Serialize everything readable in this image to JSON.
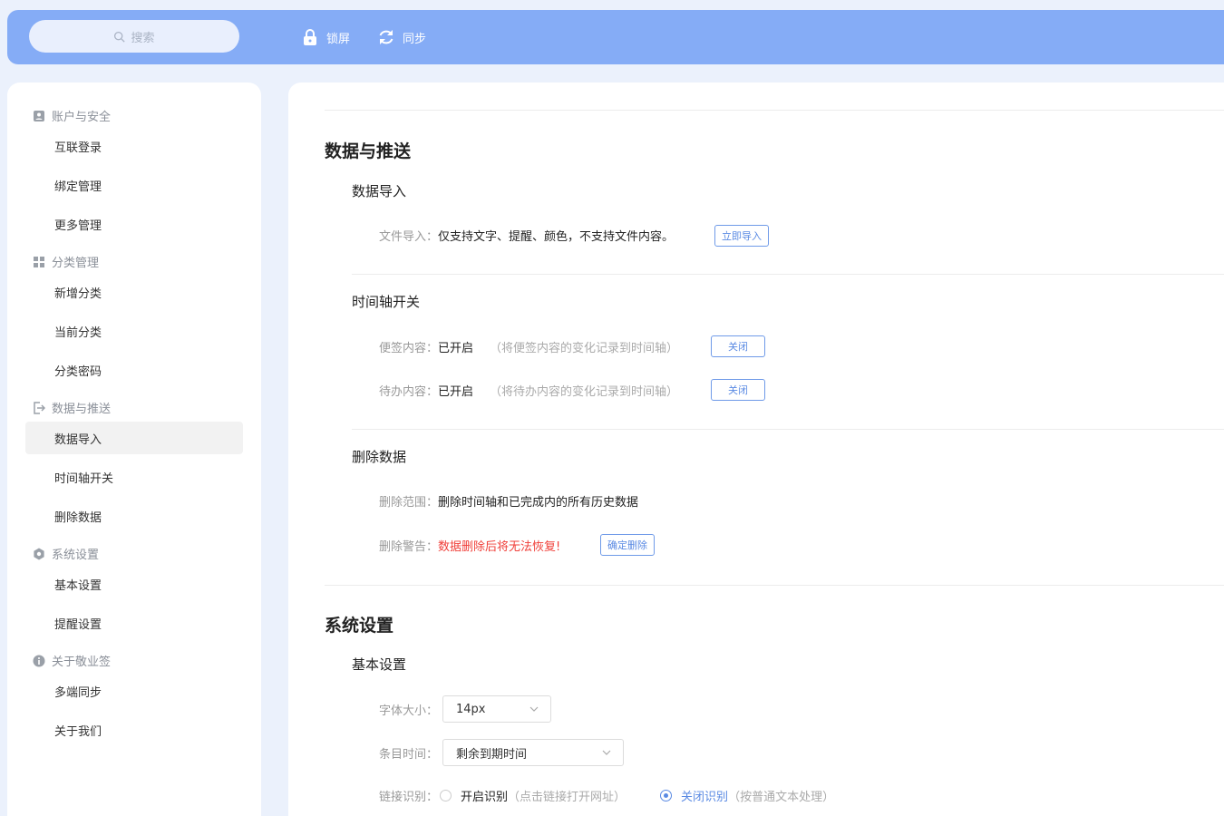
{
  "topbar": {
    "search_placeholder": "搜索",
    "lock_label": "锁屏",
    "sync_label": "同步"
  },
  "sidebar": {
    "groups": [
      {
        "title": "账户与安全",
        "icon": "account-icon",
        "items": [
          "互联登录",
          "绑定管理",
          "更多管理"
        ]
      },
      {
        "title": "分类管理",
        "icon": "grid-icon",
        "items": [
          "新增分类",
          "当前分类",
          "分类密码"
        ]
      },
      {
        "title": "数据与推送",
        "icon": "export-icon",
        "items": [
          "数据导入",
          "时间轴开关",
          "删除数据"
        ]
      },
      {
        "title": "系统设置",
        "icon": "settings-icon",
        "items": [
          "基本设置",
          "提醒设置"
        ]
      },
      {
        "title": "关于敬业签",
        "icon": "info-icon",
        "items": [
          "多端同步",
          "关于我们"
        ]
      }
    ],
    "active_item": "数据导入"
  },
  "main": {
    "data_section": {
      "title": "数据与推送",
      "import": {
        "title": "数据导入",
        "file_label": "文件导入：",
        "file_value": "仅支持文字、提醒、颜色，不支持文件内容。",
        "button": "立即导入"
      },
      "timeline": {
        "title": "时间轴开关",
        "note_label": "便签内容：",
        "note_value": "已开启",
        "note_hint": "（将便签内容的变化记录到时间轴）",
        "note_button": "关闭",
        "todo_label": "待办内容：",
        "todo_value": "已开启",
        "todo_hint": "（将待办内容的变化记录到时间轴）",
        "todo_button": "关闭"
      },
      "delete": {
        "title": "删除数据",
        "scope_label": "删除范围：",
        "scope_value": "删除时间轴和已完成内的所有历史数据",
        "warn_label": "删除警告：",
        "warn_value": "数据删除后将无法恢复!",
        "button": "确定删除"
      }
    },
    "system_section": {
      "title": "系统设置",
      "basic": {
        "title": "基本设置",
        "font_label": "字体大小：",
        "font_value": "14px",
        "time_label": "条目时间：",
        "time_value": "剩余到期时间",
        "link_label": "链接识别：",
        "link_on": "开启识别",
        "link_on_hint": "（点击链接打开网址）",
        "link_off": "关闭识别",
        "link_off_hint": "（按普通文本处理）",
        "link_selected": "关闭识别"
      }
    }
  },
  "colors": {
    "topbar": "#85acf6",
    "background": "#ebf1fc",
    "accent": "#5a8ae3",
    "warning": "#f0403a"
  }
}
